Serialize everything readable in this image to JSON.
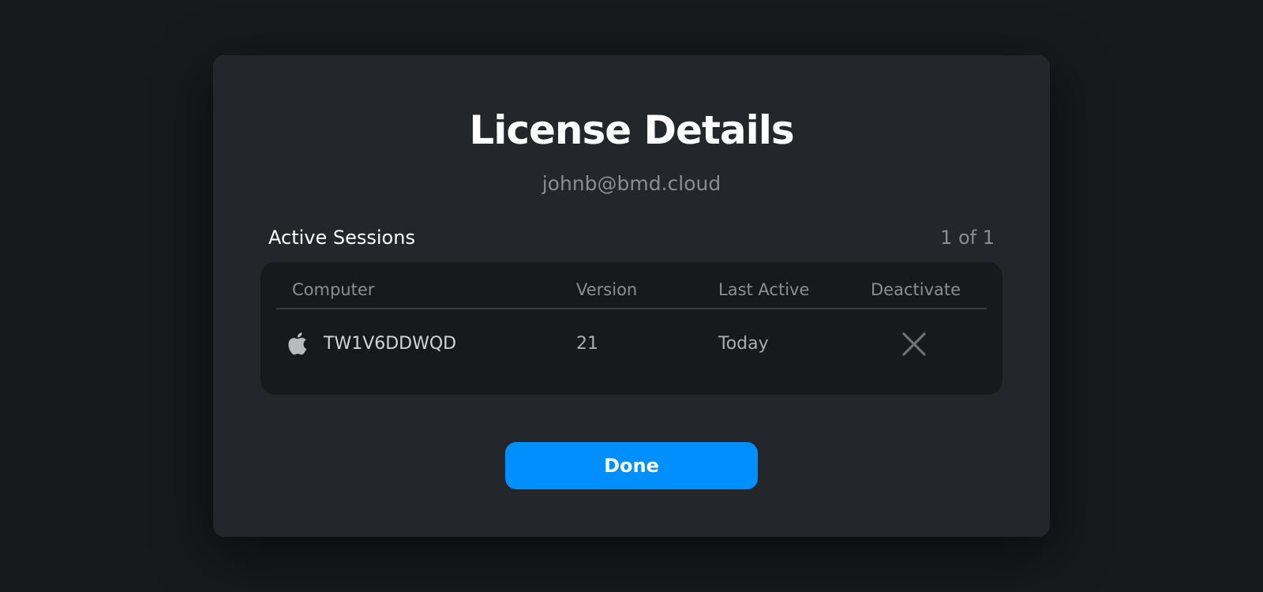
{
  "dialog": {
    "title": "License Details",
    "email": "johnb@bmd.cloud"
  },
  "sessions": {
    "label": "Active Sessions",
    "count": "1 of 1",
    "columns": [
      "Computer",
      "Version",
      "Last Active",
      "Deactivate"
    ],
    "rows": [
      {
        "os_icon": "apple-icon",
        "computer": "TW1V6DDWQD",
        "version": "21",
        "last_active": "Today",
        "deactivate_icon": "close-icon"
      }
    ]
  },
  "actions": {
    "done_label": "Done"
  },
  "colors": {
    "background": "#18191b",
    "dialog": "#23262b",
    "accent": "#008ffc"
  }
}
